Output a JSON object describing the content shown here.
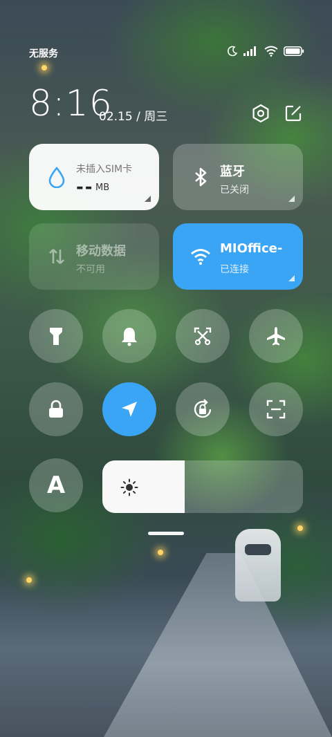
{
  "status_bar": {
    "carrier": "无服务",
    "icons": [
      "moon-icon",
      "signal-icon",
      "wifi-icon",
      "battery-icon"
    ]
  },
  "header": {
    "time": "8:16",
    "date": "02.15 / 周三",
    "icons": [
      "settings-icon",
      "edit-icon"
    ]
  },
  "tiles": {
    "sim": {
      "label": "未插入SIM卡",
      "value": "--",
      "unit": "MB",
      "icon": "water-drop-icon"
    },
    "bluetooth": {
      "title": "蓝牙",
      "status": "已关闭",
      "icon": "bluetooth-icon"
    },
    "mobile_data": {
      "title": "移动数据",
      "status": "不可用",
      "icon": "mobile-data-icon"
    },
    "wifi": {
      "title": "MIOffice-",
      "status": "已连接",
      "icon": "wifi-icon",
      "accent": "#3aa5f5"
    }
  },
  "toggles_row1": [
    {
      "name": "flashlight",
      "icon": "flashlight-icon",
      "active": false
    },
    {
      "name": "mute",
      "icon": "bell-icon",
      "active": false
    },
    {
      "name": "screenshot",
      "icon": "scissors-icon",
      "active": false
    },
    {
      "name": "airplane",
      "icon": "airplane-icon",
      "active": false
    }
  ],
  "toggles_row2": [
    {
      "name": "lock-screen",
      "icon": "lock-icon",
      "active": false
    },
    {
      "name": "location",
      "icon": "location-arrow-icon",
      "active": true
    },
    {
      "name": "rotation-lock",
      "icon": "rotation-lock-icon",
      "active": false
    },
    {
      "name": "scanner",
      "icon": "scan-icon",
      "active": false
    }
  ],
  "font_button": {
    "label": "A"
  },
  "brightness": {
    "level": 0.41,
    "icon": "sun-icon"
  },
  "colors": {
    "accent": "#3aa5f5",
    "tile_light": "#ffffff"
  }
}
